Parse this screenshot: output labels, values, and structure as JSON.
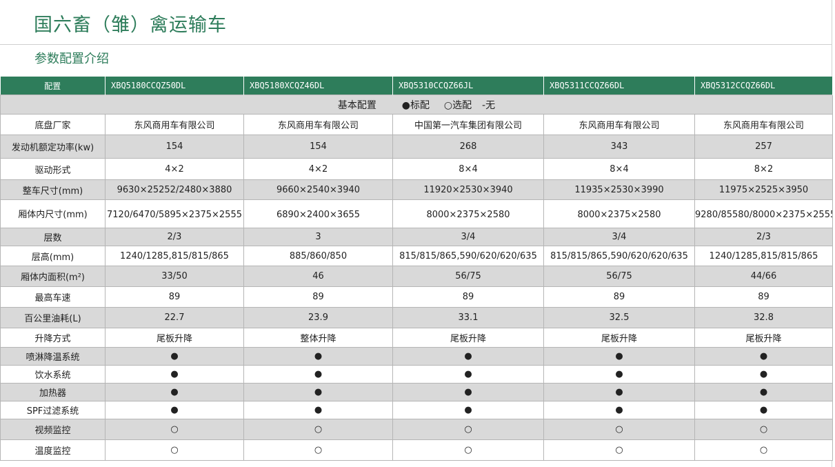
{
  "page": {
    "title": "国六畜（雏）禽运输车",
    "subtitle": "参数配置介绍"
  },
  "table": {
    "header_label": "配置",
    "models": [
      "XBQ5180CCQZ50DL",
      "XBQ5180XCQZ46DL",
      "XBQ5310CCQZ66JL",
      "XBQ5311CCQZ66DL",
      "XBQ5312CCQZ66DL"
    ],
    "section_label": "基本配置",
    "legend_standard": "●标配",
    "legend_optional": "○选配",
    "legend_none": "-无",
    "rows": [
      {
        "label": "底盘厂家",
        "values": [
          "东风商用车有限公司",
          "东风商用车有限公司",
          "中国第一汽车集团有限公司",
          "东风商用车有限公司",
          "东风商用车有限公司"
        ]
      },
      {
        "label": "发动机额定功率(kw)",
        "values": [
          "154",
          "154",
          "268",
          "343",
          "257"
        ]
      },
      {
        "label": "驱动形式",
        "values": [
          "4×2",
          "4×2",
          "8×4",
          "8×4",
          "8×2"
        ]
      },
      {
        "label": "整车尺寸(mm)",
        "values": [
          "9630×25252/2480×3880",
          "9660×2540×3940",
          "11920×2530×3940",
          "11935×2530×3990",
          "11975×2525×3950"
        ]
      },
      {
        "label": "厢体内尺寸(mm)",
        "values": [
          "7120/6470/5895×2375×2555",
          "6890×2400×3655",
          "8000×2375×2580",
          "8000×2375×2580",
          "9280/85580/8000×2375×2555"
        ]
      },
      {
        "label": "层数",
        "values": [
          "2/3",
          "3",
          "3/4",
          "3/4",
          "2/3"
        ]
      },
      {
        "label": "层高(mm)",
        "values": [
          "1240/1285,815/815/865",
          "885/860/850",
          "815/815/865,590/620/620/635",
          "815/815/865,590/620/620/635",
          "1240/1285,815/815/865"
        ]
      },
      {
        "label": "厢体内面积(m²)",
        "values": [
          "33/50",
          "46",
          "56/75",
          "56/75",
          "44/66"
        ]
      },
      {
        "label": "最高车速",
        "values": [
          "89",
          "89",
          "89",
          "89",
          "89"
        ]
      },
      {
        "label": "百公里油耗(L)",
        "values": [
          "22.7",
          "23.9",
          "33.1",
          "32.5",
          "32.8"
        ]
      },
      {
        "label": "升降方式",
        "values": [
          "尾板升降",
          "整体升降",
          "尾板升降",
          "尾板升降",
          "尾板升降"
        ]
      },
      {
        "label": "喷淋降温系统",
        "values": [
          "●",
          "●",
          "●",
          "●",
          "●"
        ]
      },
      {
        "label": "饮水系统",
        "values": [
          "●",
          "●",
          "●",
          "●",
          "●"
        ]
      },
      {
        "label": "加热器",
        "values": [
          "●",
          "●",
          "●",
          "●",
          "●"
        ]
      },
      {
        "label": "SPF过滤系统",
        "values": [
          "●",
          "●",
          "●",
          "●",
          "●"
        ]
      },
      {
        "label": "视频监控",
        "values": [
          "○",
          "○",
          "○",
          "○",
          "○"
        ]
      },
      {
        "label": "温度监控",
        "values": [
          "○",
          "○",
          "○",
          "○",
          "○"
        ]
      }
    ]
  }
}
